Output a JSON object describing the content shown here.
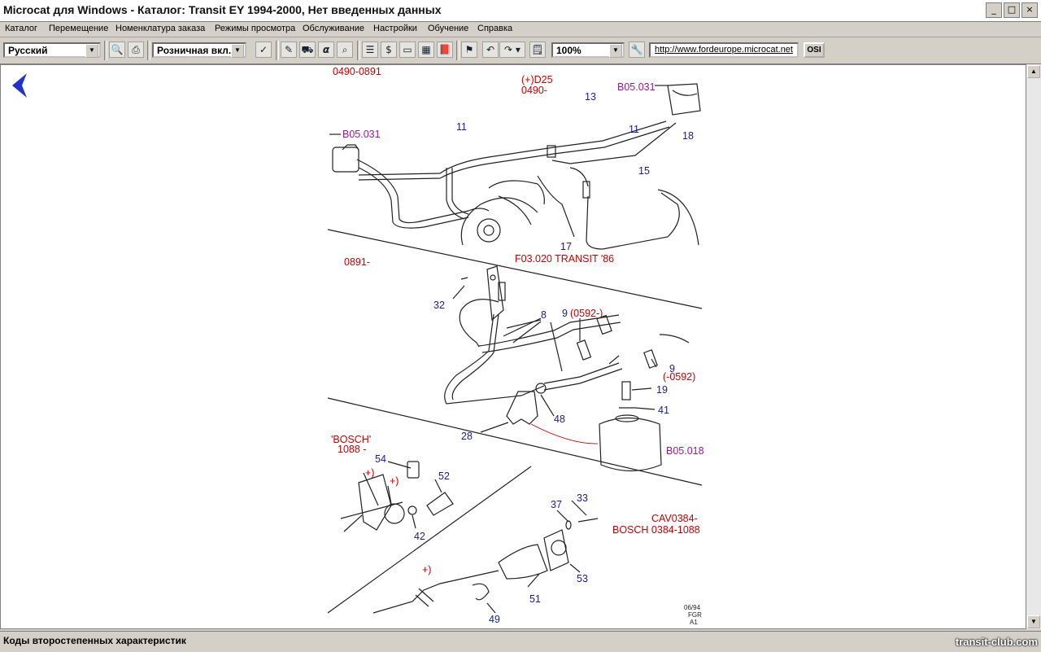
{
  "window": {
    "title": "Microcat для Windows - Каталог: Transit EY 1994-2000, Нет введенных данных",
    "minimize_glyph": "_",
    "restore_glyph": "□",
    "close_glyph": "×"
  },
  "menu": {
    "items": [
      "Каталог",
      "Перемещение",
      "Номенклатура заказа",
      "Режимы просмотра",
      "Обслуживание",
      "Настройки",
      "Обучение",
      "Справка"
    ]
  },
  "toolbar": {
    "language": "Русский",
    "price_mode": "Розничная вкл.",
    "zoom": "100%",
    "url": "http://www.fordeurope.microcat.net",
    "osi_label": "OSI",
    "alpha_glyph": "α"
  },
  "diagram": {
    "labels": {
      "range_top": "0490-0891",
      "d25_1": "(+)D25",
      "d25_2": "0490-",
      "ref_b05_031_right": "B05.031",
      "ref_b05_031_left": "B05.031",
      "n11_a": "11",
      "n11_b": "11",
      "n13": "13",
      "n15": "15",
      "n17": "17",
      "n18": "18",
      "ref_f03": "F03.020 TRANSIT '86",
      "range_mid": "0891-",
      "n32": "32",
      "n8": "8",
      "n9_a": "9",
      "n9_a_note": "(0592-)",
      "n9_b": "9",
      "n9_b_note": "(-0592)",
      "n19": "19",
      "n41": "41",
      "n48": "48",
      "n28": "28",
      "ref_b05_018": "B05.018",
      "bosch_1": "'BOSCH'",
      "bosch_2": "1088 -",
      "n54": "54",
      "n52": "52",
      "n42": "42",
      "plus_1": "+)",
      "plus_2": "+)",
      "plus_3": "+)",
      "n37": "37",
      "n33": "33",
      "n53": "53",
      "n51": "51",
      "n49": "49",
      "cav_1": "CAV0384-",
      "cav_2": "BOSCH 0384-1088",
      "stamp_1": "06/94",
      "stamp_2": "FGR",
      "stamp_3": "A1"
    }
  },
  "status": {
    "text": "Коды второстепенных характеристик",
    "watermark": "transit-club.com"
  },
  "colors": {
    "chrome": "#d4d0c8",
    "red_label": "#cc0000",
    "blue_label": "#1a1a9a",
    "magenta_label": "#9a1a9a",
    "back_arrow": "#2233cc"
  }
}
